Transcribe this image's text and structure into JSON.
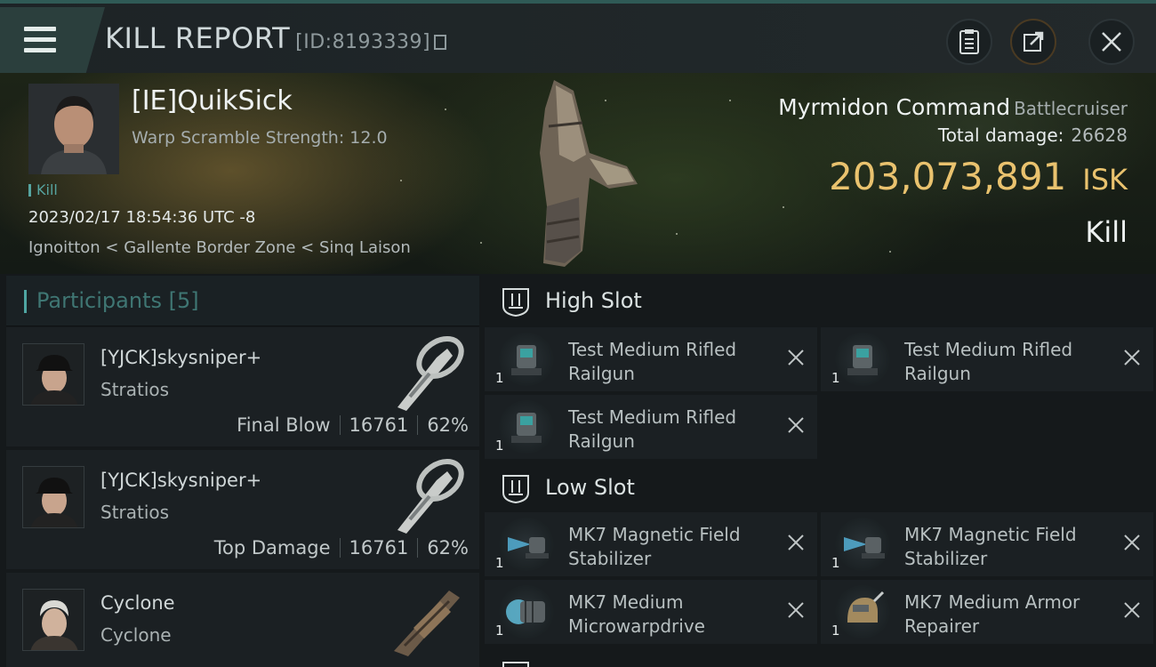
{
  "header": {
    "title": "KILL REPORT",
    "report_id": "[ID:8193339]",
    "icons": [
      "menu-icon",
      "copy-icon",
      "clipboard-icon",
      "share-icon",
      "close-icon"
    ]
  },
  "victim": {
    "name": "[IE]QuikSick",
    "warp_scramble": "Warp Scramble Strength: 12.0",
    "tag": "Kill",
    "datetime": "2023/02/17 18:54:36 UTC -8",
    "location": "Ignoitton < Gallente Border Zone < Sinq Laison",
    "ship_name": "Myrmidon Command",
    "ship_class": "Battlecruiser",
    "total_damage_label": "Total damage:",
    "total_damage": "26628",
    "isk_value": "203,073,891",
    "isk_unit": "ISK",
    "result": "Kill"
  },
  "participants": {
    "label": "Participants",
    "count": "[5]",
    "rows": [
      {
        "name": "[YJCK]skysniper+",
        "ship": "Stratios",
        "role": "Final Blow",
        "damage": "16761",
        "percent": "62%"
      },
      {
        "name": "[YJCK]skysniper+",
        "ship": "Stratios",
        "role": "Top Damage",
        "damage": "16761",
        "percent": "62%"
      },
      {
        "name": "Cyclone",
        "ship": "Cyclone"
      }
    ]
  },
  "fitting": {
    "high_slot": {
      "label": "High Slot",
      "modules": [
        {
          "name": "Test Medium Rifled Railgun",
          "qty": "1"
        },
        {
          "name": "Test Medium Rifled Railgun",
          "qty": "1"
        },
        {
          "name": "Test Medium Rifled Railgun",
          "qty": "1"
        }
      ]
    },
    "low_slot": {
      "label": "Low Slot",
      "modules": [
        {
          "name": "MK7 Magnetic Field Stabilizer",
          "qty": "1"
        },
        {
          "name": "MK7 Magnetic Field Stabilizer",
          "qty": "1"
        },
        {
          "name": "MK7 Medium Microwarpdrive",
          "qty": "1"
        },
        {
          "name": "MK7 Medium Armor Repairer",
          "qty": "1"
        }
      ]
    }
  },
  "colors": {
    "accent_teal": "#4fa6a2",
    "isk_gold": "#e9c26e",
    "panel": "#1b2023"
  }
}
